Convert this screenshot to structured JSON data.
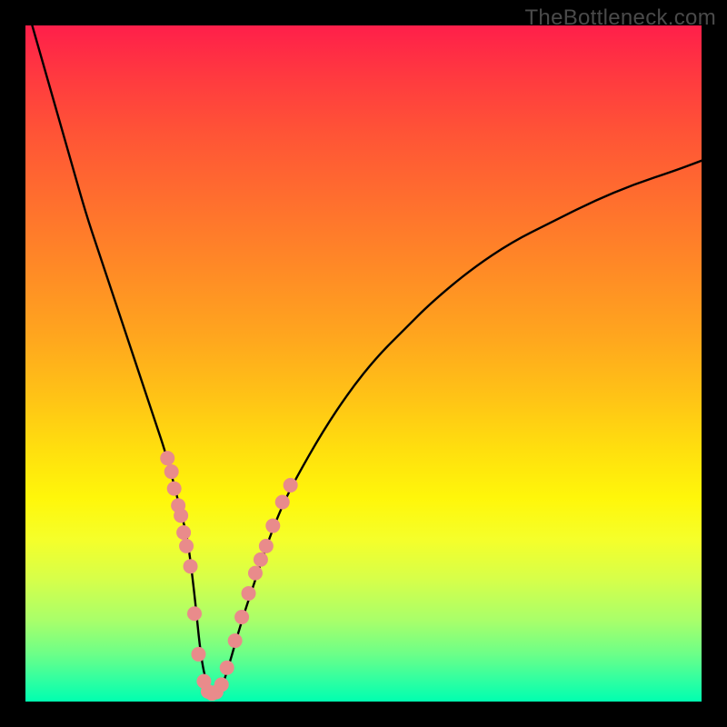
{
  "watermark": "TheBottleneck.com",
  "chart_data": {
    "type": "line",
    "title": "",
    "xlabel": "",
    "ylabel": "",
    "xlim": [
      0,
      100
    ],
    "ylim": [
      0,
      100
    ],
    "grid": false,
    "legend": false,
    "annotations": [],
    "series": [
      {
        "name": "curve",
        "color": "#000000",
        "x": [
          1,
          3,
          5,
          7,
          9,
          11,
          13,
          15,
          17,
          19,
          21,
          23,
          24,
          25,
          26,
          27,
          28,
          29,
          30,
          32,
          34,
          36,
          38,
          40,
          44,
          48,
          52,
          56,
          60,
          66,
          72,
          78,
          84,
          90,
          96,
          100
        ],
        "values": [
          100,
          93,
          86,
          79,
          72,
          66,
          60,
          54,
          48,
          42,
          36,
          28,
          24,
          16,
          6,
          2,
          1,
          2,
          5,
          12,
          18,
          24,
          29,
          33,
          40,
          46,
          51,
          55,
          59,
          64,
          68,
          71,
          74,
          76.5,
          78.5,
          80
        ]
      }
    ],
    "markers": [
      {
        "name": "dots",
        "color": "#e98b8b",
        "points": [
          {
            "x": 21.0,
            "y": 36.0
          },
          {
            "x": 21.6,
            "y": 34.0
          },
          {
            "x": 22.0,
            "y": 31.5
          },
          {
            "x": 22.6,
            "y": 29.0
          },
          {
            "x": 23.0,
            "y": 27.5
          },
          {
            "x": 23.4,
            "y": 25.0
          },
          {
            "x": 23.8,
            "y": 23.0
          },
          {
            "x": 24.4,
            "y": 20.0
          },
          {
            "x": 25.0,
            "y": 13.0
          },
          {
            "x": 25.6,
            "y": 7.0
          },
          {
            "x": 26.4,
            "y": 3.0
          },
          {
            "x": 27.0,
            "y": 1.5
          },
          {
            "x": 27.6,
            "y": 1.2
          },
          {
            "x": 28.2,
            "y": 1.4
          },
          {
            "x": 29.0,
            "y": 2.5
          },
          {
            "x": 29.8,
            "y": 5.0
          },
          {
            "x": 31.0,
            "y": 9.0
          },
          {
            "x": 32.0,
            "y": 12.5
          },
          {
            "x": 33.0,
            "y": 16.0
          },
          {
            "x": 34.0,
            "y": 19.0
          },
          {
            "x": 34.8,
            "y": 21.0
          },
          {
            "x": 35.6,
            "y": 23.0
          },
          {
            "x": 36.6,
            "y": 26.0
          },
          {
            "x": 38.0,
            "y": 29.5
          },
          {
            "x": 39.2,
            "y": 32.0
          }
        ]
      }
    ]
  }
}
